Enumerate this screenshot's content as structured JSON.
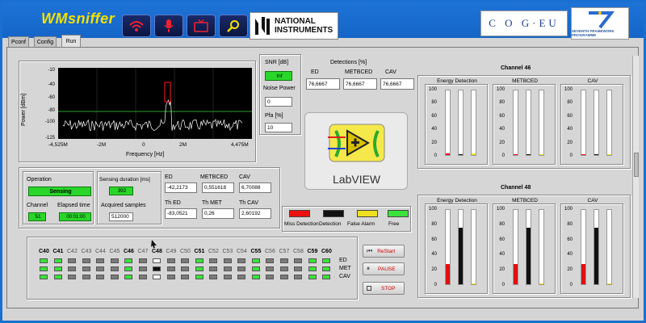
{
  "app": {
    "title": "WMsniffer"
  },
  "header": {
    "ni_logo_text": [
      "NATIONAL",
      "INSTRUMENTS"
    ],
    "cog_logo": "C O G·EU",
    "fp7_logo": "SEVENTH FRAMEWORK PROGRAMME"
  },
  "tabs": [
    {
      "label": "Pconf"
    },
    {
      "label": "Config"
    },
    {
      "label": "Run"
    }
  ],
  "spectrum": {
    "ylabel": "Power [dBm]",
    "xlabel": "Frequency [Hz]",
    "yticks": [
      "-10",
      "-40",
      "-60",
      "-80",
      "-100",
      "-125"
    ],
    "xticks": [
      "-4,525M",
      "-2M",
      "0",
      "2M",
      "4,475M"
    ]
  },
  "snr": {
    "label": "SNR [dB]",
    "value": "Inf"
  },
  "noise_power": {
    "label": "Noise Power",
    "value": "0"
  },
  "pfa": {
    "label": "Pfa [%]",
    "value": "10"
  },
  "detections": {
    "title": "Detections [%]",
    "labels": [
      "ED",
      "METBCED",
      "CAV"
    ],
    "values": [
      "76,6667",
      "76,6667",
      "76,6667"
    ]
  },
  "labview": {
    "label": "LabVIEW"
  },
  "operation": {
    "label": "Operation",
    "value": "Sensing",
    "channel_label": "Channel",
    "channel_value": "51",
    "elapsed_label": "Elapsed time",
    "elapsed_value": "00:01:00"
  },
  "sensing": {
    "duration_label": "Sensing duration [ms]",
    "duration_value": "392",
    "samples_label": "Acquired samples",
    "samples_value": "512000"
  },
  "metrics": {
    "ed_label": "ED",
    "ed_value": "-42,2173",
    "met_label": "METBCED",
    "met_value": "0,551618",
    "cav_label": "CAV",
    "cav_value": "6,70088",
    "thed_label": "Th ED",
    "thed_value": "-83,0521",
    "thmet_label": "Th MET",
    "thmet_value": "0,26",
    "thcav_label": "Th CAV",
    "thcav_value": "2,60192"
  },
  "legend": {
    "items": [
      "Miss Detection",
      "Detection",
      "False Alarm",
      "Free"
    ],
    "colors": [
      "#ee1111",
      "#111111",
      "#f0e020",
      "#39e339"
    ]
  },
  "channel46": {
    "title": "Channel 46",
    "groups": [
      "Energy Detection",
      "METBCED",
      "CAV"
    ],
    "levels": [
      [
        2,
        1,
        2
      ],
      [
        1,
        1,
        1
      ],
      [
        1,
        1,
        1
      ]
    ]
  },
  "channel48": {
    "title": "Channel 48",
    "groups": [
      "Energy Detection",
      "METBCED",
      "CAV"
    ],
    "levels": [
      [
        27,
        76,
        1
      ],
      [
        27,
        76,
        1
      ],
      [
        27,
        76,
        1
      ]
    ]
  },
  "gauge_ticks": [
    "100",
    "80",
    "60",
    "40",
    "20",
    "0"
  ],
  "grid": {
    "channels": [
      "C40",
      "C41",
      "C42",
      "C43",
      "C44",
      "C45",
      "C46",
      "C47",
      "C48",
      "C49",
      "C50",
      "C51",
      "C52",
      "C53",
      "C54",
      "C55",
      "C56",
      "C57",
      "C58",
      "C59",
      "C60"
    ],
    "row_labels": [
      "ED",
      "MET",
      "CAV"
    ]
  },
  "controls": {
    "restart": "ReStart",
    "pause": "PAUSE",
    "stop": "STOP"
  }
}
